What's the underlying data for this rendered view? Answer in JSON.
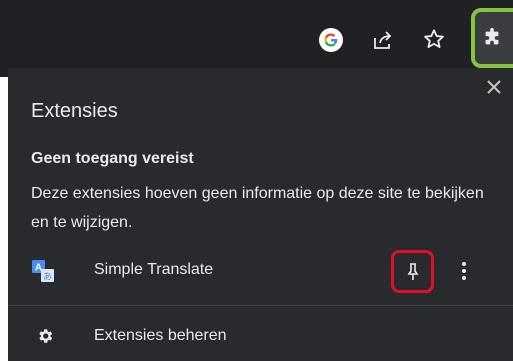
{
  "toolbar": {
    "icons": [
      "google-icon",
      "share-icon",
      "star-icon",
      "puzzle-icon"
    ],
    "highlight_color": "#86c440"
  },
  "panel": {
    "title": "Extensies",
    "section": {
      "heading": "Geen toegang vereist",
      "description": "Deze extensies hoeven geen informatie op deze site te bekijken en te wijzigen."
    },
    "extensions": [
      {
        "name": "Simple Translate",
        "icon": "translate-icon",
        "pinned": false
      }
    ],
    "manage_label": "Extensies beheren",
    "pin_highlight_color": "#e0102a"
  },
  "colors": {
    "toolbar_bg": "#202124",
    "panel_bg": "#292a2d",
    "text": "#e8eaed"
  }
}
